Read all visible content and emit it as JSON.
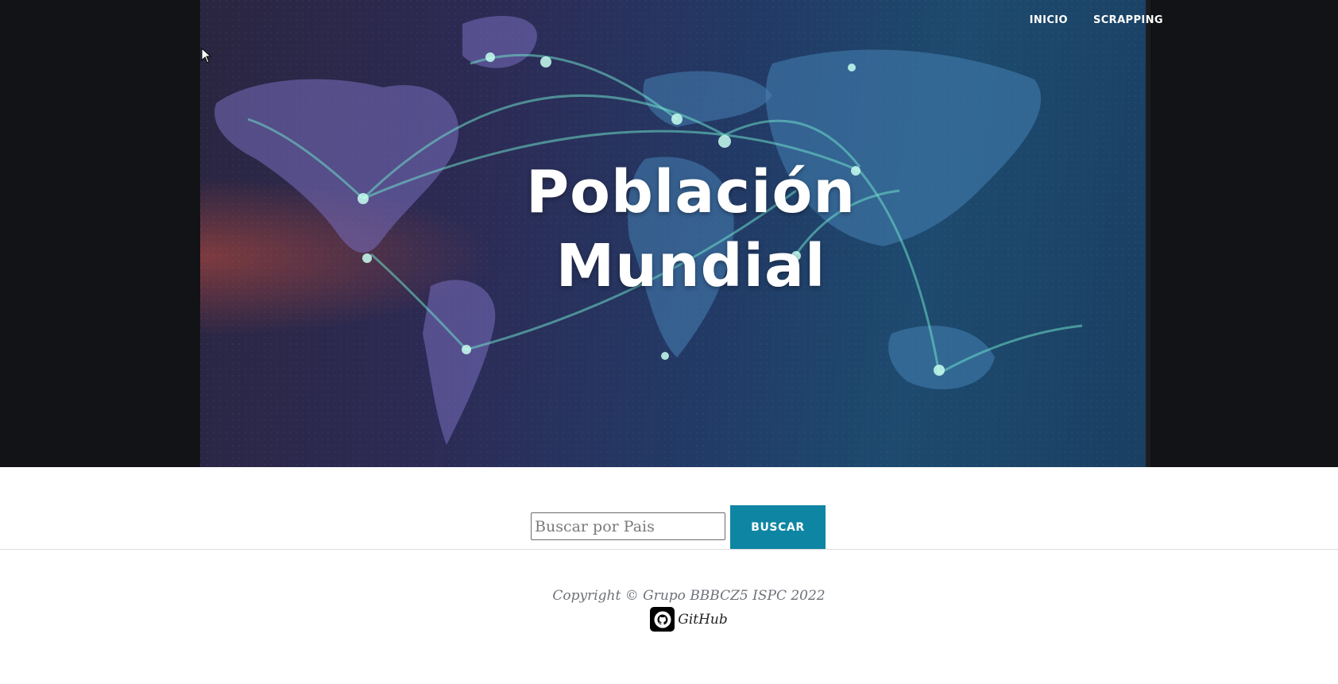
{
  "nav": {
    "items": [
      {
        "label": "INICIO"
      },
      {
        "label": "SCRAPPING"
      }
    ]
  },
  "hero": {
    "title_line1": "Población",
    "title_line2": "Mundial"
  },
  "search": {
    "placeholder": "Buscar por Pais",
    "value": "",
    "button_label": "BUSCAR"
  },
  "footer": {
    "copyright": "Copyright © Grupo BBBCZ5 ISPC 2022",
    "github_label": "GitHub"
  },
  "colors": {
    "hero_background": "#121316",
    "accent": "#0e86a3",
    "footer_text": "#6c7278"
  },
  "icons": {
    "github": "github-icon",
    "cursor": "mouse-pointer-icon",
    "hero_image": "world-map-image"
  }
}
